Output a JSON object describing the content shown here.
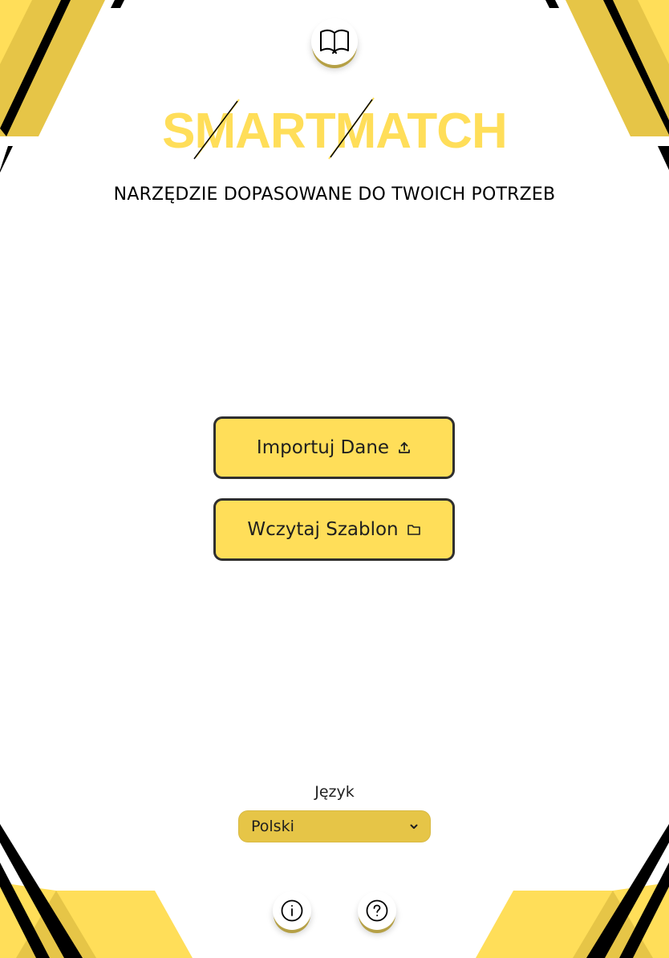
{
  "app": {
    "logo_text_part1": "SMART",
    "logo_text_part2": "MATCH",
    "tagline": "NARZĘDZIE DOPASOWANE DO TWOICH POTRZEB"
  },
  "top": {
    "icon": "open-book-icon"
  },
  "actions": {
    "import": {
      "label": "Importuj Dane",
      "icon": "upload-icon"
    },
    "load": {
      "label": "Wczytaj Szablon",
      "icon": "folder-icon"
    }
  },
  "language": {
    "label": "Język",
    "selected": "Polski",
    "icon": "chevron-down-icon"
  },
  "footer": {
    "info_icon": "info-icon",
    "help_icon": "help-icon"
  },
  "colors": {
    "accent_yellow": "#ffde59",
    "accent_dark_yellow": "#e6c547",
    "black": "#000000",
    "white": "#ffffff"
  }
}
